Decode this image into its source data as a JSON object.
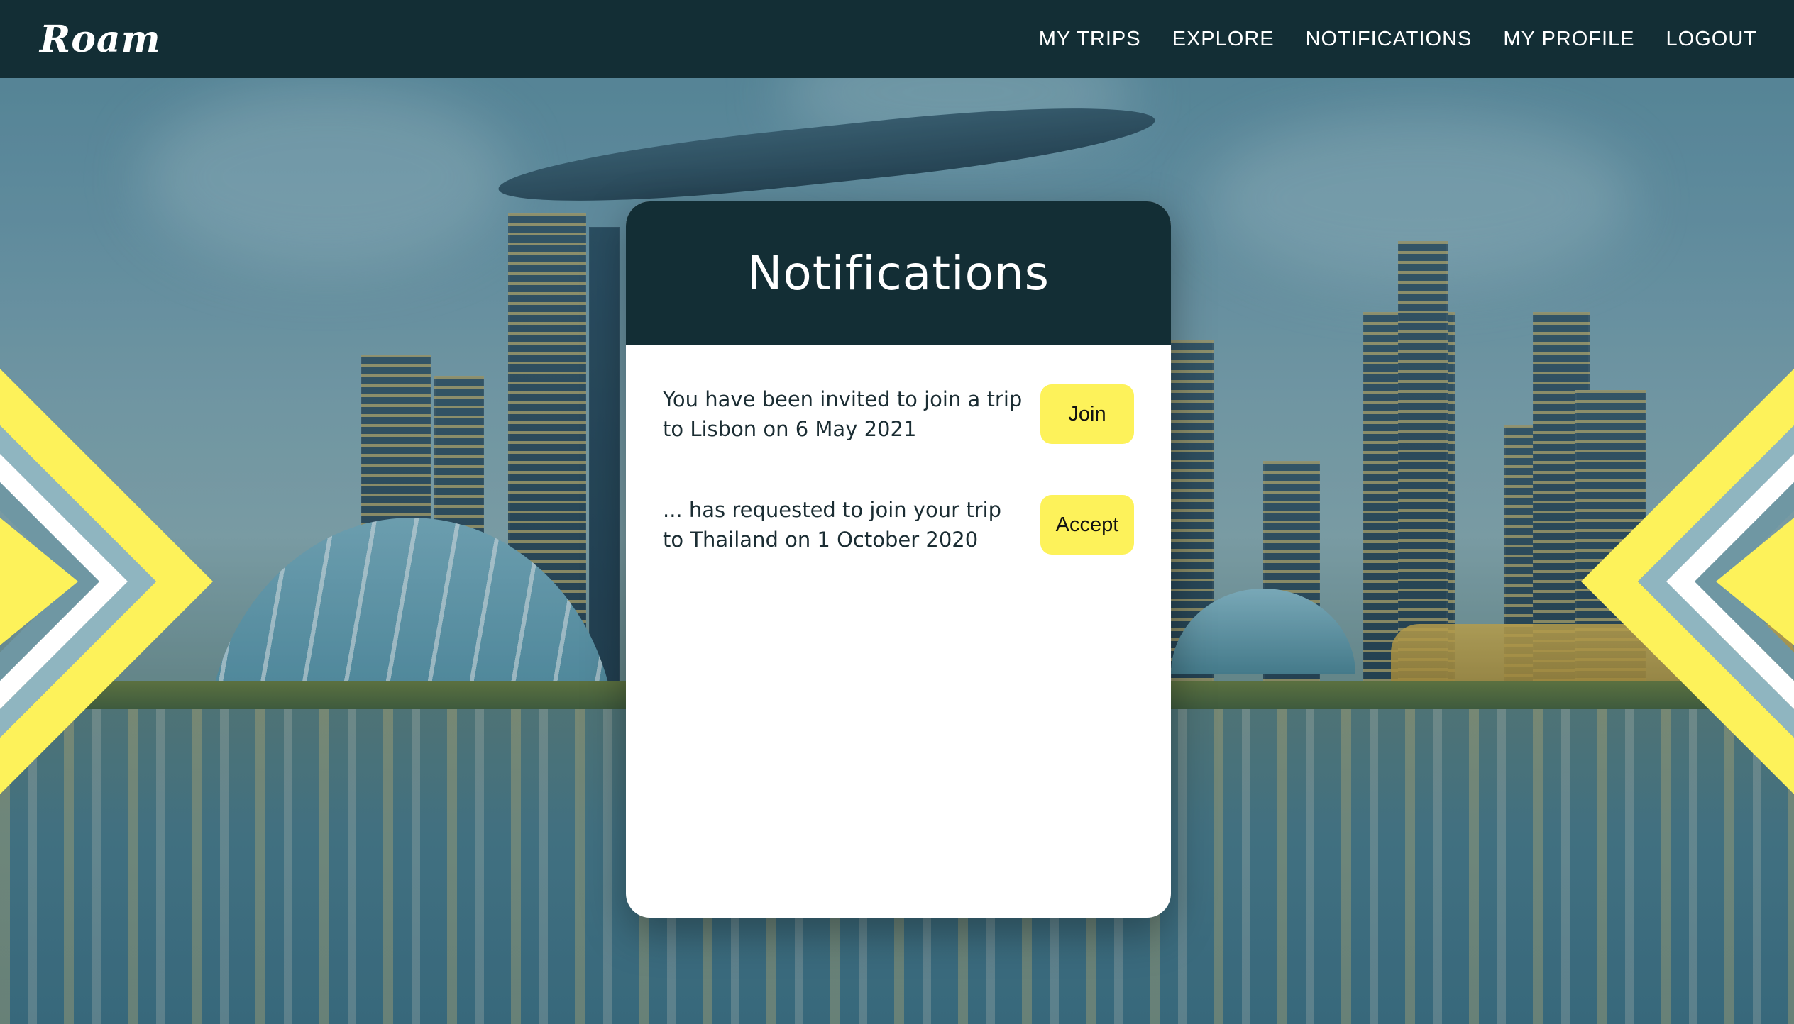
{
  "app": {
    "logo": "Roam"
  },
  "nav": {
    "items": [
      "MY TRIPS",
      "EXPLORE",
      "NOTIFICATIONS",
      "MY PROFILE",
      "LOGOUT"
    ]
  },
  "card": {
    "title": "Notifications",
    "notifications": [
      {
        "text": "You have been invited to join a trip to Lisbon on 6 May 2021",
        "action": "Join"
      },
      {
        "text": "... has requested to join your trip to Thailand on 1 October 2020",
        "action": "Accept"
      }
    ]
  },
  "colors": {
    "nav_bg": "#132e35",
    "accent_yellow": "#fdf25a",
    "card_bg": "#ffffff",
    "text_dark": "#1b2d33"
  }
}
